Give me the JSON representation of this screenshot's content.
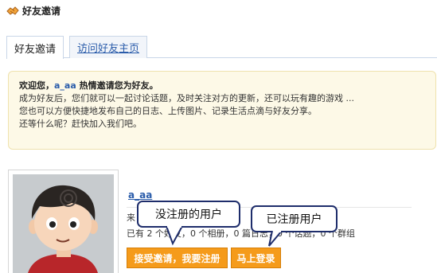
{
  "header": {
    "title": "好友邀请",
    "icon": "invite-hands-icon"
  },
  "tabs": [
    {
      "label": "好友邀请",
      "active": true
    },
    {
      "label": "访问好友主页",
      "active": false
    }
  ],
  "notice": {
    "greeting_prefix": "欢迎您，",
    "username": "a_aa",
    "greeting_suffix": " 热情邀请您为好友。",
    "line2": "成为好友后，您们就可以一起讨论话题，及时关注对方的更新，还可以玩有趣的游戏 ...",
    "line3": "您也可以方便快捷地发布自己的日志、上传图片、记录生活点滴与好友分享。",
    "line4": "还等什么呢？赶快加入我们吧。"
  },
  "profile": {
    "username": "a_aa",
    "line1": "来",
    "stats": "已有 2 个好友，0 个相册，0 篇日志，0 个话题，0 个群组"
  },
  "buttons": {
    "accept": "接受邀请，我要注册",
    "login": "马上登录"
  },
  "callouts": {
    "unregistered": "没注册的用户",
    "registered": "已注册用户"
  },
  "colors": {
    "button_bg": "#f59b1b",
    "link": "#2a5caa",
    "notice_bg": "#fdf9e7",
    "callout_border": "#1e2d6b"
  }
}
